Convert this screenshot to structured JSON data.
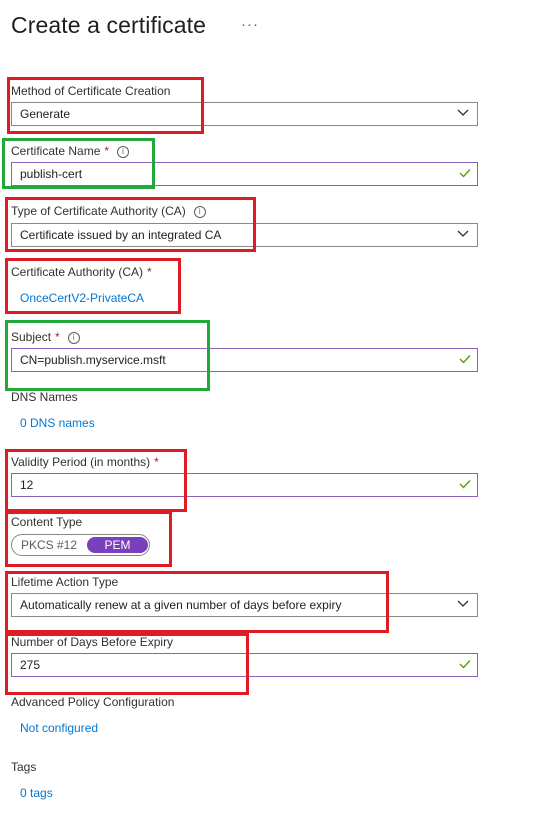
{
  "page": {
    "title": "Create a certificate",
    "more": "···"
  },
  "fields": {
    "method": {
      "label": "Method of Certificate Creation",
      "value": "Generate"
    },
    "name": {
      "label": "Certificate Name",
      "required": "*",
      "value": "publish-cert"
    },
    "ca_type": {
      "label": "Type of Certificate Authority (CA)",
      "value": "Certificate issued by an integrated CA"
    },
    "ca": {
      "label": "Certificate Authority (CA)",
      "required": "*",
      "value": "OnceCertV2-PrivateCA"
    },
    "subject": {
      "label": "Subject",
      "required": "*",
      "value": "CN=publish.myservice.msft"
    },
    "dns": {
      "label": "DNS Names",
      "value": "0 DNS names"
    },
    "validity": {
      "label": "Validity Period (in months)",
      "required": "*",
      "value": "12"
    },
    "content_type": {
      "label": "Content Type",
      "options": [
        "PKCS #12",
        "PEM"
      ],
      "selected": "PEM"
    },
    "lifetime": {
      "label": "Lifetime Action Type",
      "value": "Automatically renew at a given number of days before expiry"
    },
    "days": {
      "label": "Number of Days Before Expiry",
      "value": "275"
    },
    "advanced": {
      "label": "Advanced Policy Configuration",
      "value": "Not configured"
    },
    "tags": {
      "label": "Tags",
      "value": "0 tags"
    }
  },
  "colors": {
    "link": "#0078d4",
    "valid_border": "#8764b8",
    "check": "#57a300",
    "toggle_selected": "#7a3fbb",
    "highlight_red": "#e01b24",
    "highlight_green": "#21a838"
  },
  "icons": {
    "info": "info-icon",
    "chevron": "chevron-down-icon",
    "check": "checkmark-icon"
  }
}
